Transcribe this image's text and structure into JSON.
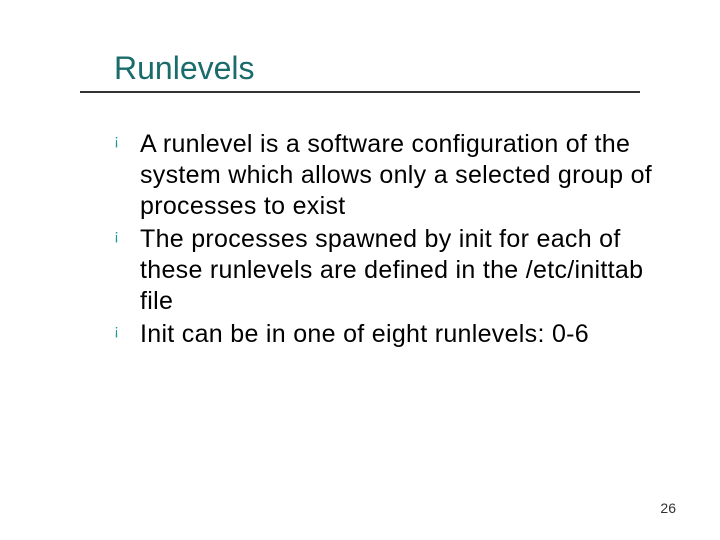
{
  "slide": {
    "title": "Runlevels",
    "bullets": [
      "A runlevel is a software configuration of the system which allows only a selected group of processes to exist",
      "The processes spawned by init for each of these runlevels are defined in the /etc/inittab file",
      "Init can be in one of eight runlevels: 0-6"
    ],
    "page_number": "26",
    "bullet_marker": "¡"
  }
}
